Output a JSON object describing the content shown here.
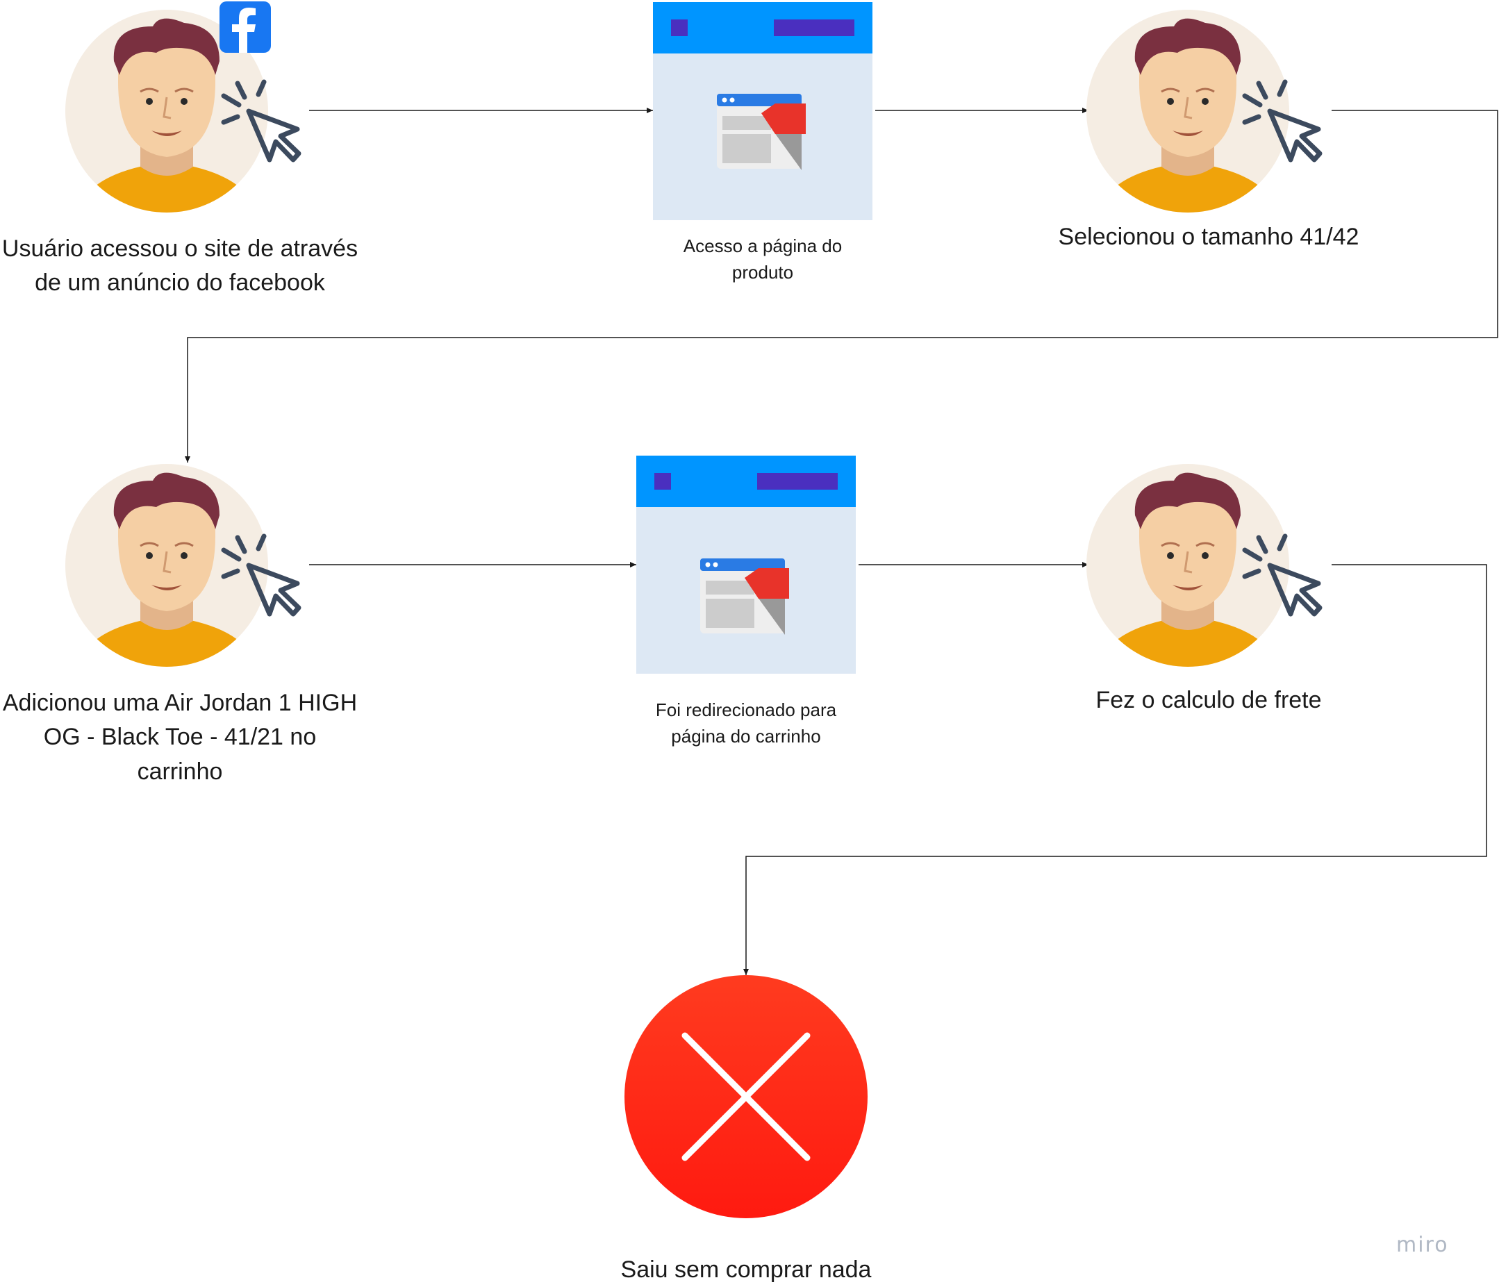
{
  "steps": [
    {
      "id": "step-1",
      "kind": "user",
      "label_lines": [
        "Usuário acessou o site de através",
        "de um anúncio do facebook"
      ],
      "badge": "facebook-icon"
    },
    {
      "id": "step-2",
      "kind": "page",
      "label_lines": [
        "Acesso a página do",
        "produto"
      ]
    },
    {
      "id": "step-3",
      "kind": "user",
      "label_lines": [
        "Selecionou o tamanho 41/42"
      ]
    },
    {
      "id": "step-4",
      "kind": "user",
      "label_lines": [
        "Adicionou uma Air Jordan 1 HIGH",
        "OG - Black Toe - 41/21 no",
        "carrinho"
      ]
    },
    {
      "id": "step-5",
      "kind": "page",
      "label_lines": [
        "Foi redirecionado para",
        "página do carrinho"
      ]
    },
    {
      "id": "step-6",
      "kind": "user",
      "label_lines": [
        "Fez o calculo de frete"
      ]
    },
    {
      "id": "step-7",
      "kind": "exit",
      "label_lines": [
        "Saiu sem comprar nada"
      ]
    }
  ],
  "watermark": "miro",
  "colors": {
    "facebook": "#1877f2",
    "browser_header": "#0095ff",
    "browser_body": "#dde8f4",
    "accent_purple": "#4a2fbf",
    "exit_red": "#ff2a1a",
    "avatar_bg": "#f5ede3",
    "shirt": "#f0a30a",
    "hair": "#7a3040",
    "skin": "#f5cfa4",
    "cursor": "#3c4a5e",
    "line": "#1a1a1a",
    "watermark": "#b0b8c4"
  }
}
